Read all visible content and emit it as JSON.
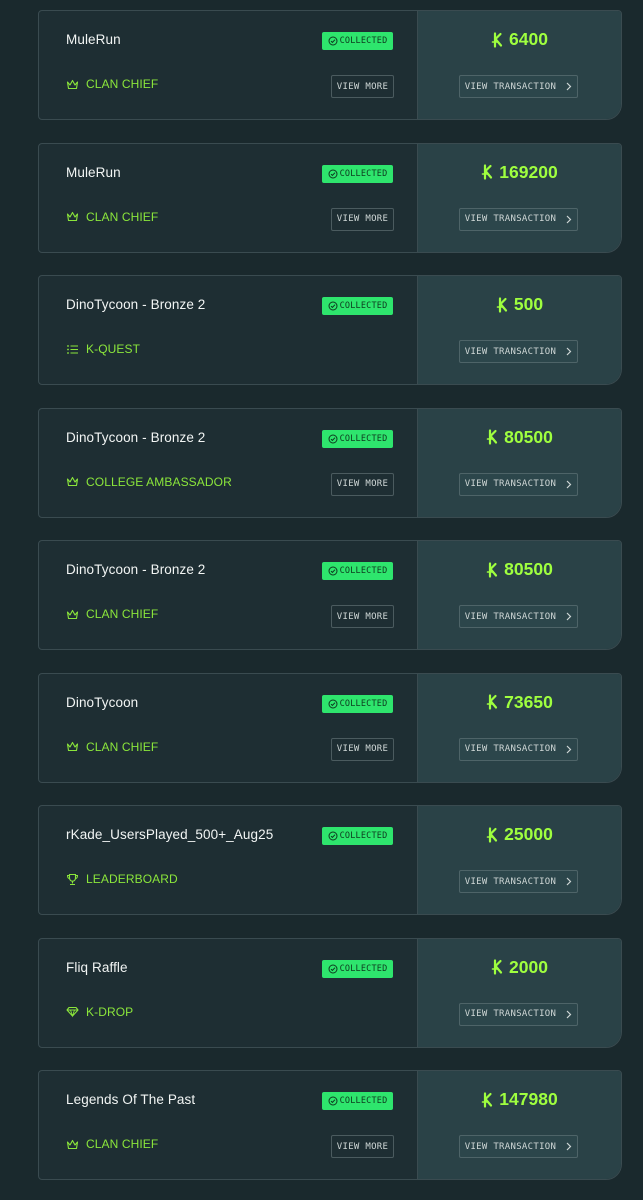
{
  "labels": {
    "collected": "COLLECTED",
    "view_more": "VIEW MORE",
    "view_transaction": "VIEW TRANSACTION"
  },
  "colors": {
    "accent": "#9fff3f",
    "badge": "#2ee56d",
    "category": "#8be63b"
  },
  "transactions": [
    {
      "title": "MuleRun",
      "category": "CLAN CHIEF",
      "category_icon": "crown-icon",
      "amount": "6400",
      "has_view_more": true
    },
    {
      "title": "MuleRun",
      "category": "CLAN CHIEF",
      "category_icon": "crown-icon",
      "amount": "169200",
      "has_view_more": true
    },
    {
      "title": "DinoTycoon - Bronze 2",
      "category": "K-QUEST",
      "category_icon": "list-icon",
      "amount": "500",
      "has_view_more": false
    },
    {
      "title": "DinoTycoon - Bronze 2",
      "category": "COLLEGE AMBASSADOR",
      "category_icon": "crown-icon",
      "amount": "80500",
      "has_view_more": true
    },
    {
      "title": "DinoTycoon - Bronze 2",
      "category": "CLAN CHIEF",
      "category_icon": "crown-icon",
      "amount": "80500",
      "has_view_more": true
    },
    {
      "title": "DinoTycoon",
      "category": "CLAN CHIEF",
      "category_icon": "crown-icon",
      "amount": "73650",
      "has_view_more": true
    },
    {
      "title": "rKade_UsersPlayed_500+_Aug25",
      "category": "LEADERBOARD",
      "category_icon": "trophy-icon",
      "amount": "25000",
      "has_view_more": false
    },
    {
      "title": "Fliq Raffle",
      "category": "K-DROP",
      "category_icon": "gem-icon",
      "amount": "2000",
      "has_view_more": false
    },
    {
      "title": "Legends Of The Past",
      "category": "CLAN CHIEF",
      "category_icon": "crown-icon",
      "amount": "147980",
      "has_view_more": true
    }
  ]
}
